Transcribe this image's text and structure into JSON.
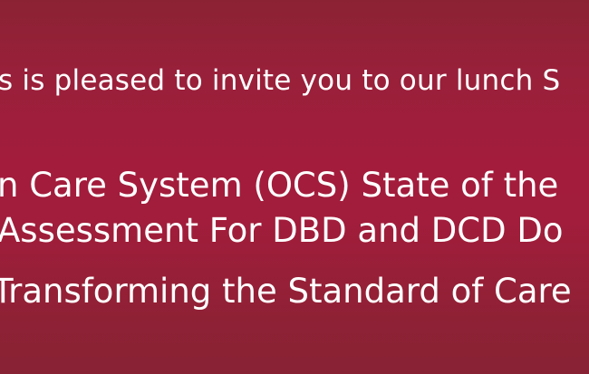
{
  "banner": {
    "lines": [
      "s is pleased to invite you to our lunch S",
      "n Care System (OCS) State of the",
      "Assessment For DBD and DCD Do",
      "Transforming the Standard of Care"
    ]
  }
}
